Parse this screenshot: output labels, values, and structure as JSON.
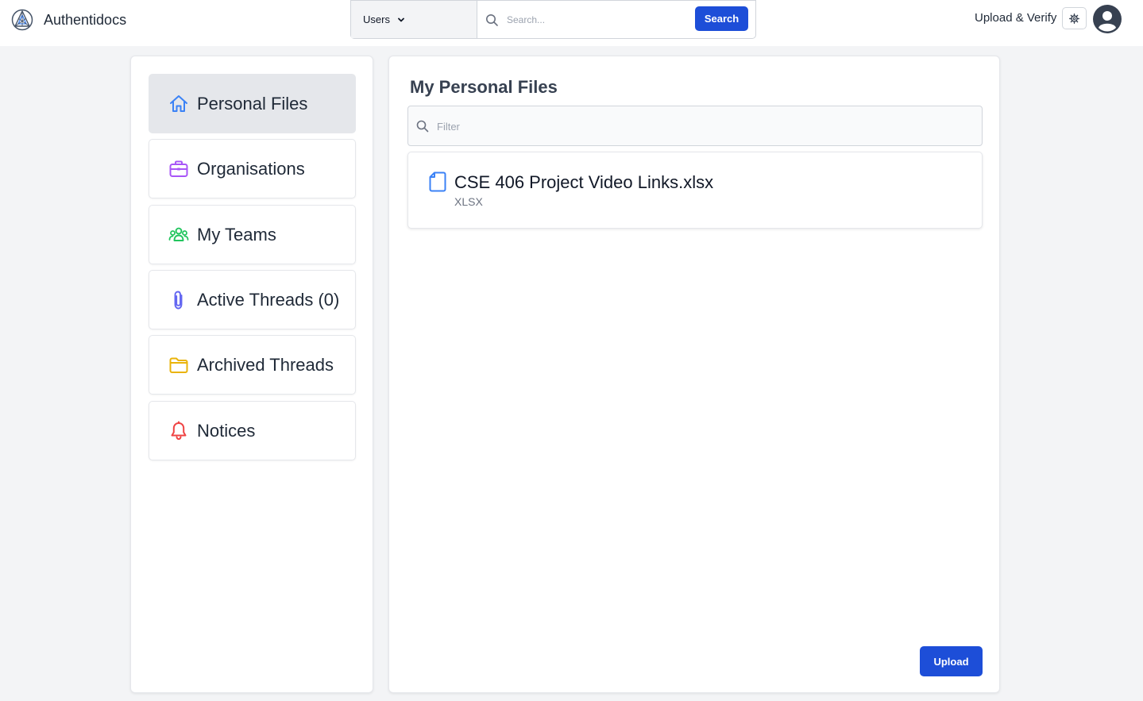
{
  "header": {
    "brand_name": "Authentidocs",
    "search_scope": "Users",
    "search_placeholder": "Search...",
    "search_button": "Search",
    "upload_verify": "Upload & Verify",
    "icons": {
      "logo": "triangle-logo-icon",
      "chevron": "chevron-down-icon",
      "search": "search-icon",
      "settings": "gear-icon",
      "avatar": "user-avatar-icon"
    }
  },
  "sidebar": {
    "items": [
      {
        "label": "Personal Files",
        "icon": "home-icon",
        "color": "#3b82f6",
        "active": true
      },
      {
        "label": "Organisations",
        "icon": "briefcase-icon",
        "color": "#a855f7",
        "active": false
      },
      {
        "label": "My Teams",
        "icon": "users-icon",
        "color": "#22c55e",
        "active": false
      },
      {
        "label": "Active Threads (0)",
        "icon": "paperclip-icon",
        "color": "#6366f1",
        "active": false
      },
      {
        "label": "Archived Threads",
        "icon": "folder-icon",
        "color": "#eab308",
        "active": false
      },
      {
        "label": "Notices",
        "icon": "bell-icon",
        "color": "#ef4444",
        "active": false
      }
    ]
  },
  "main": {
    "title": "My Personal Files",
    "filter_placeholder": "Filter",
    "files": [
      {
        "name": "CSE 406 Project Video Links.xlsx",
        "type": "XLSX",
        "icon": "document-icon"
      }
    ],
    "upload_button": "Upload"
  },
  "colors": {
    "primary": "#1d4ed8",
    "background": "#f3f4f6",
    "active_item": "#e5e7eb"
  }
}
